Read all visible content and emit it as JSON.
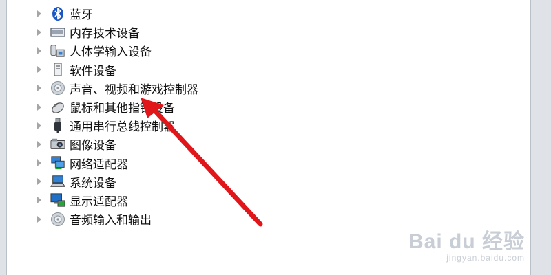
{
  "tree": {
    "items": [
      {
        "label": "蓝牙",
        "icon": "bluetooth-icon"
      },
      {
        "label": "内存技术设备",
        "icon": "memory-device-icon"
      },
      {
        "label": "人体学输入设备",
        "icon": "hid-device-icon"
      },
      {
        "label": "软件设备",
        "icon": "software-device-icon"
      },
      {
        "label": "声音、视频和游戏控制器",
        "icon": "sound-video-game-icon"
      },
      {
        "label": "鼠标和其他指针设备",
        "icon": "mouse-icon"
      },
      {
        "label": "通用串行总线控制器",
        "icon": "usb-icon"
      },
      {
        "label": "图像设备",
        "icon": "imaging-device-icon"
      },
      {
        "label": "网络适配器",
        "icon": "network-adapter-icon"
      },
      {
        "label": "系统设备",
        "icon": "system-device-icon"
      },
      {
        "label": "显示适配器",
        "icon": "display-adapter-icon"
      },
      {
        "label": "音频输入和输出",
        "icon": "audio-io-icon"
      }
    ]
  },
  "annotation": {
    "color": "#e0161b"
  },
  "watermark": {
    "main": "Bai du 经验",
    "sub": "jingyan.baidu.com"
  }
}
